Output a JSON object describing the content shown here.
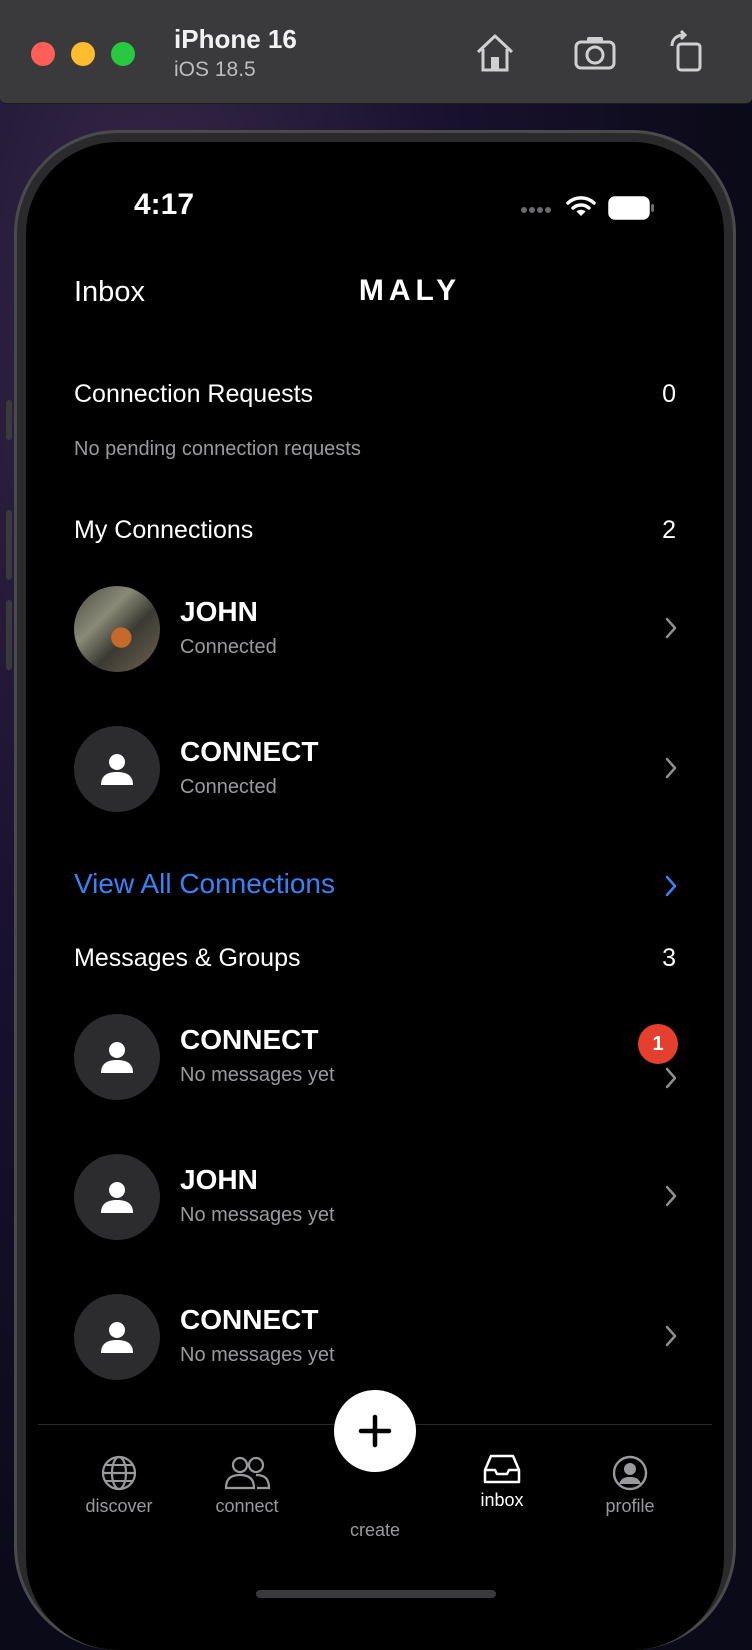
{
  "simulator": {
    "device_name": "iPhone 16",
    "os_version": "iOS 18.5"
  },
  "status_bar": {
    "time": "4:17"
  },
  "header": {
    "left_title": "Inbox",
    "brand": "MALY"
  },
  "connection_requests": {
    "title": "Connection Requests",
    "count": "0",
    "empty_text": "No pending connection requests"
  },
  "my_connections": {
    "title": "My Connections",
    "count": "2",
    "items": [
      {
        "name": "JOHN",
        "status": "Connected",
        "avatar": "photo"
      },
      {
        "name": "CONNECT",
        "status": "Connected",
        "avatar": "person-icon"
      }
    ],
    "view_all_label": "View All Connections"
  },
  "messages": {
    "title": "Messages & Groups",
    "count": "3",
    "items": [
      {
        "name": "CONNECT",
        "preview": "No messages yet",
        "unread": "1"
      },
      {
        "name": "JOHN",
        "preview": "No messages yet"
      },
      {
        "name": "CONNECT",
        "preview": "No messages yet"
      }
    ]
  },
  "tabbar": {
    "tabs": [
      {
        "label": "discover",
        "icon": "globe-icon"
      },
      {
        "label": "connect",
        "icon": "people-icon"
      },
      {
        "label": "create",
        "icon": "plus-icon"
      },
      {
        "label": "inbox",
        "icon": "inbox-icon",
        "active": true
      },
      {
        "label": "profile",
        "icon": "profile-icon"
      }
    ]
  },
  "colors": {
    "accent_link": "#3a82f7",
    "badge": "#e5402f",
    "background": "#000000"
  }
}
